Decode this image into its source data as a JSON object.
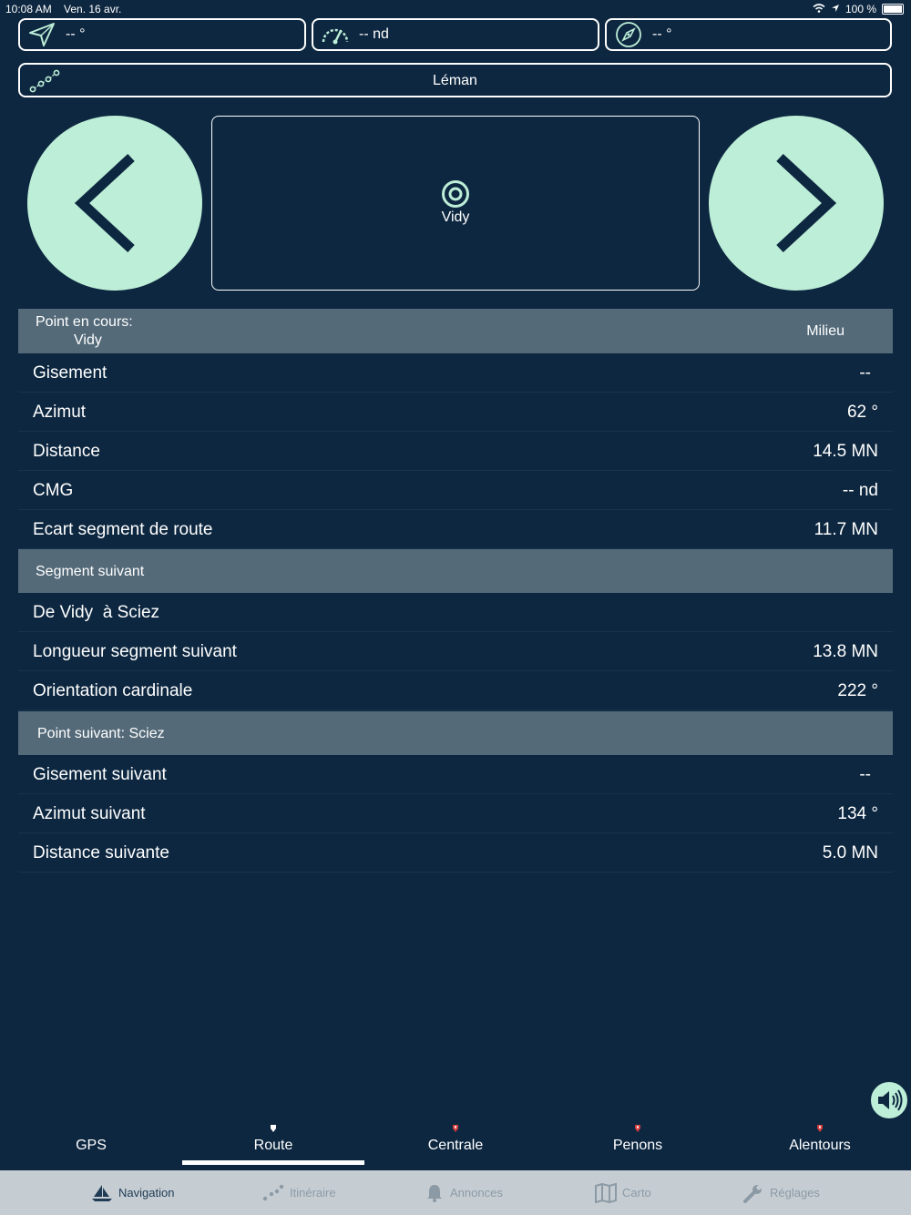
{
  "status": {
    "time": "10:08 AM",
    "date": "Ven. 16 avr.",
    "battery": "100 %"
  },
  "top": {
    "heading_value": "-- °",
    "speed_value": "-- nd",
    "compass_value": "-- °",
    "route_name": "Léman"
  },
  "waypoint": {
    "name": "Vidy"
  },
  "current_section": {
    "title": "Point en cours:",
    "name": "Vidy",
    "right": "Milieu"
  },
  "rows_current": [
    {
      "label": "Gisement",
      "value": "--"
    },
    {
      "label": "Azimut",
      "value": "62  °"
    },
    {
      "label": "Distance",
      "value": "14.5  MN"
    },
    {
      "label": "CMG",
      "value": "--  nd"
    },
    {
      "label": "Ecart segment de route",
      "value": "11.7  MN"
    }
  ],
  "segment_section": {
    "title": "Segment suivant"
  },
  "rows_segment": [
    {
      "label": "De Vidy  à Sciez",
      "value": ""
    },
    {
      "label": "Longueur segment suivant",
      "value": "13.8  MN"
    },
    {
      "label": "Orientation cardinale",
      "value": "222  °"
    }
  ],
  "next_section": {
    "title": "Point suivant: Sciez"
  },
  "rows_next": [
    {
      "label": "Gisement suivant",
      "value": "--"
    },
    {
      "label": "Azimut suivant",
      "value": "134  °"
    },
    {
      "label": "Distance suivante",
      "value": "5.0  MN"
    }
  ],
  "subtabs": [
    "GPS",
    "Route",
    "Centrale",
    "Penons",
    "Alentours"
  ],
  "tabbar": [
    "Navigation",
    "Itinéraire",
    "Annonces",
    "Carto",
    "Réglages"
  ],
  "colors": {
    "background": "#0d2740",
    "accent": "#bdeed7",
    "section": "#546a79",
    "marker": "#d23c3c"
  }
}
